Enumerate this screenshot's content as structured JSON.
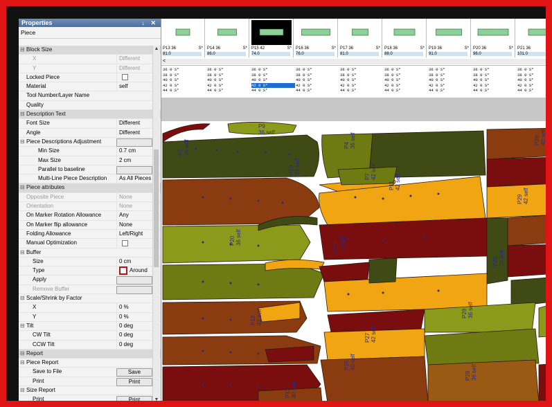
{
  "panel": {
    "title": "Properties",
    "title_buttons": "↓ ✕",
    "subtitle": "Piece",
    "rows": [
      {
        "type": "cat",
        "exp": "⊟",
        "name": "Block Size",
        "value": ""
      },
      {
        "type": "dis",
        "name": "X",
        "value": "Different",
        "indent": 1
      },
      {
        "type": "dis",
        "name": "Y",
        "value": "Different",
        "indent": 1
      },
      {
        "type": "norm",
        "name": "Locked Piece",
        "value": "",
        "check": true
      },
      {
        "type": "norm",
        "name": "Material",
        "value": "self"
      },
      {
        "type": "norm",
        "name": "Tool Number/Layer Name",
        "value": ""
      },
      {
        "type": "norm",
        "name": "Quality",
        "value": ""
      },
      {
        "type": "cat",
        "exp": "⊟",
        "name": "Description Text",
        "value": ""
      },
      {
        "type": "norm",
        "name": "Font Size",
        "value": "Different"
      },
      {
        "type": "norm",
        "name": "Angle",
        "value": "Different"
      },
      {
        "type": "norm",
        "exp": "⊟",
        "name": "Piece Descriptions Adjustment",
        "value": "",
        "button": ""
      },
      {
        "type": "norm",
        "name": "Min Size",
        "value": "0.7 cm",
        "indent": 2
      },
      {
        "type": "norm",
        "name": "Max Size",
        "value": "2 cm",
        "indent": 2
      },
      {
        "type": "norm",
        "name": "Parallel to baseline",
        "value": "",
        "button": "",
        "indent": 2
      },
      {
        "type": "norm",
        "name": "Multi-Line Piece Description",
        "value": "As All Pieces",
        "indent": 2
      },
      {
        "type": "cat",
        "exp": "⊟",
        "name": "Piece attributes",
        "value": ""
      },
      {
        "type": "dis",
        "name": "Opposite Piece",
        "value": "None"
      },
      {
        "type": "dis",
        "name": "Orientation",
        "value": "None"
      },
      {
        "type": "norm",
        "name": "On Marker Rotation Allowance",
        "value": "Any"
      },
      {
        "type": "norm",
        "name": "On Marker flip allowance",
        "value": "None"
      },
      {
        "type": "norm",
        "name": "Folding Allowance",
        "value": "Left/Right"
      },
      {
        "type": "norm",
        "name": "Manual Optimization",
        "value": "",
        "check": true
      },
      {
        "type": "norm",
        "exp": "⊟",
        "name": "Buffer",
        "value": ""
      },
      {
        "type": "norm",
        "name": "Size",
        "value": "0 cm",
        "indent": 1
      },
      {
        "type": "norm",
        "name": "Type",
        "value": "Around",
        "redbox": true,
        "indent": 1
      },
      {
        "type": "norm",
        "name": "Apply",
        "value": "",
        "button": "",
        "indent": 1
      },
      {
        "type": "dis",
        "name": "Remove Buffer",
        "value": "",
        "button": "",
        "indent": 1
      },
      {
        "type": "norm",
        "exp": "⊟",
        "name": "Scale/Shrink by Factor",
        "value": ""
      },
      {
        "type": "norm",
        "name": "X",
        "value": "0 %",
        "indent": 1
      },
      {
        "type": "norm",
        "name": "Y",
        "value": "0 %",
        "indent": 1
      },
      {
        "type": "norm",
        "exp": "⊟",
        "name": "Tilt",
        "value": "0 deg"
      },
      {
        "type": "norm",
        "name": "CW Tilt",
        "value": "0 deg",
        "indent": 1
      },
      {
        "type": "norm",
        "name": "CCW Tilt",
        "value": "0 deg",
        "indent": 1
      },
      {
        "type": "cat",
        "exp": "⊟",
        "name": "Report",
        "value": ""
      },
      {
        "type": "norm",
        "exp": "⊟",
        "name": "Piece Report",
        "value": ""
      },
      {
        "type": "norm",
        "name": "Save to File",
        "value": "",
        "button": "Save",
        "indent": 1
      },
      {
        "type": "norm",
        "name": "Print",
        "value": "",
        "button": "Print",
        "indent": 1
      },
      {
        "type": "norm",
        "exp": "⊟",
        "name": "Size Report",
        "value": ""
      },
      {
        "type": "norm",
        "name": "Print",
        "value": "",
        "button": "Print",
        "indent": 1
      }
    ]
  },
  "thumbnails": [
    {
      "name": "P13 36",
      "qty": "S*",
      "value": "81.0",
      "selected": false,
      "color": "#8fd09a"
    },
    {
      "name": "P14 36",
      "qty": "S*",
      "value": "86.0",
      "selected": false,
      "color": "#8fd09a"
    },
    {
      "name": "P15 42",
      "qty": "S*",
      "value": "74.0",
      "selected": true,
      "color": "#8fd09a"
    },
    {
      "name": "P16 36",
      "qty": "S*",
      "value": "76.0",
      "selected": false,
      "color": "#8fd09a"
    },
    {
      "name": "P17 36",
      "qty": "S*",
      "value": "81.0",
      "selected": false,
      "color": "#8fd09a"
    },
    {
      "name": "P18 36",
      "qty": "S*",
      "value": "88.0",
      "selected": false,
      "color": "#8fd09a"
    },
    {
      "name": "P19 36",
      "qty": "S*",
      "value": "91.0",
      "selected": false,
      "color": "#8fd09a"
    },
    {
      "name": "P20 36",
      "qty": "S*",
      "value": "96.0",
      "selected": false,
      "color": "#8fd09a"
    },
    {
      "name": "P21 36",
      "qty": "S*",
      "value": "101.0",
      "selected": false,
      "color": "#8fd09a"
    }
  ],
  "scroll_left_arrow": "<",
  "size_rows": [
    "36 0  S*",
    "38 0  S*",
    "40 0  S*",
    "42 0  S*",
    "44 0  S*"
  ],
  "highlighted_size_col": 2,
  "highlighted_size_row": 3,
  "pieces": [
    {
      "label": "P9",
      "sub": "36 self"
    },
    {
      "label": "P2",
      "sub": "36 self"
    },
    {
      "label": "P4",
      "sub": "36 self"
    },
    {
      "label": "P29",
      "sub": "40 self"
    },
    {
      "label": "P11",
      "sub": "42 self"
    },
    {
      "label": "P7",
      "sub": "42 self"
    },
    {
      "label": "P10",
      "sub": "36 self"
    },
    {
      "label": "P20",
      "sub": "36 self"
    },
    {
      "label": "P19",
      "sub": "38 self"
    },
    {
      "label": "P29",
      "sub": "42 self"
    },
    {
      "label": "P18",
      "sub": "42 self"
    },
    {
      "label": "P26",
      "sub": "36 self"
    },
    {
      "label": "P29",
      "sub": "36 self"
    },
    {
      "label": "P27",
      "sub": "42 self"
    },
    {
      "label": "P26",
      "sub": "40 self"
    },
    {
      "label": "P28",
      "sub": "36 self"
    },
    {
      "label": "P12",
      "sub": "40 self"
    }
  ],
  "colors": {
    "dark_red": "#7a0d0d",
    "olive": "#6e7a12",
    "dark_olive": "#3f4a14",
    "orange": "#f2a512",
    "brown": "#8a3c10",
    "tan": "#9a5a14",
    "light_olive": "#8c9a1c"
  }
}
